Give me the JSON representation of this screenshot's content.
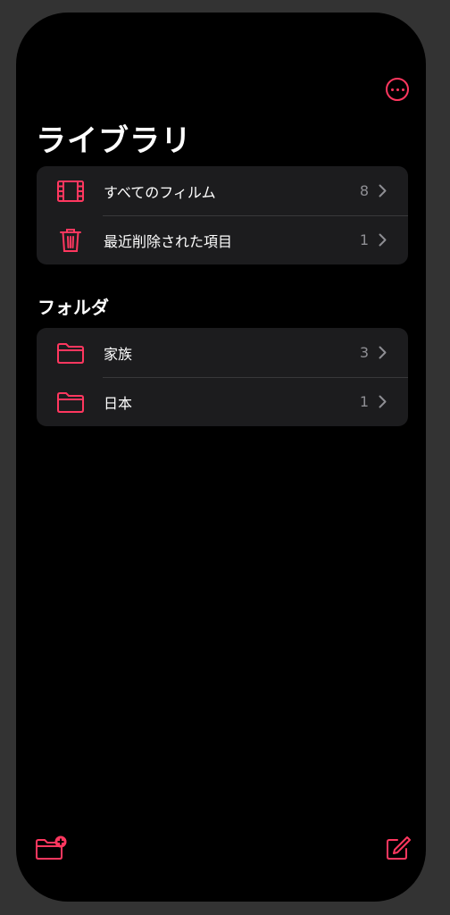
{
  "header": {
    "title": "ライブラリ",
    "more_icon": "ellipsis-circle-icon"
  },
  "library": {
    "items": [
      {
        "label": "すべてのフィルム",
        "count": "8",
        "icon": "film-icon"
      },
      {
        "label": "最近削除された項目",
        "count": "1",
        "icon": "trash-icon"
      }
    ]
  },
  "folders": {
    "header": "フォルダ",
    "items": [
      {
        "label": "家族",
        "count": "3",
        "icon": "folder-icon"
      },
      {
        "label": "日本",
        "count": "1",
        "icon": "folder-icon"
      }
    ]
  },
  "toolbar": {
    "new_folder_icon": "folder-plus-icon",
    "compose_icon": "compose-icon"
  },
  "colors": {
    "accent": "#ff375f",
    "background": "#000000",
    "cell": "#1c1c1e",
    "secondary_text": "#8e8e93"
  }
}
